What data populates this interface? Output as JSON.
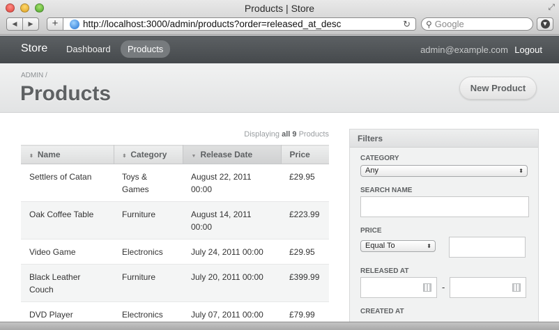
{
  "browser": {
    "window_title": "Products | Store",
    "url": "http://localhost:3000/admin/products?order=released_at_desc",
    "search_placeholder": "Google"
  },
  "header": {
    "brand": "Store",
    "nav": [
      {
        "label": "Dashboard",
        "active": false
      },
      {
        "label": "Products",
        "active": true
      }
    ],
    "user_email": "admin@example.com",
    "logout_label": "Logout"
  },
  "titlebar": {
    "breadcrumb": "ADMIN /",
    "title": "Products",
    "new_button": "New Product"
  },
  "table": {
    "displaying_prefix": "Displaying",
    "displaying_bold": "all 9",
    "displaying_suffix": "Products",
    "columns": [
      {
        "label": "Name",
        "sortable": true,
        "sorted": false
      },
      {
        "label": "Category",
        "sortable": true,
        "sorted": false
      },
      {
        "label": "Release Date",
        "sortable": true,
        "sorted": true
      },
      {
        "label": "Price",
        "sortable": false,
        "sorted": false
      }
    ],
    "rows": [
      [
        "Settlers of Catan",
        "Toys & Games",
        "August 22, 2011 00:00",
        "£29.95"
      ],
      [
        "Oak Coffee Table",
        "Furniture",
        "August 14, 2011 00:00",
        "£223.99"
      ],
      [
        "Video Game",
        "Electronics",
        "July 24, 2011 00:00",
        "£29.95"
      ],
      [
        "Black Leather Couch",
        "Furniture",
        "July 20, 2011 00:00",
        "£399.99"
      ],
      [
        "DVD Player",
        "Electronics",
        "July 07, 2011 00:00",
        "£79.99"
      ]
    ]
  },
  "filters": {
    "title": "Filters",
    "category_label": "CATEGORY",
    "category_value": "Any",
    "search_name_label": "SEARCH NAME",
    "price_label": "PRICE",
    "price_operator": "Equal To",
    "released_at_label": "RELEASED AT",
    "range_separator": "-",
    "created_at_label": "CREATED AT"
  },
  "colors": {
    "appbar": "#4f5356",
    "title_text": "#5e6163",
    "sorted_header": "#d6d7d8"
  }
}
